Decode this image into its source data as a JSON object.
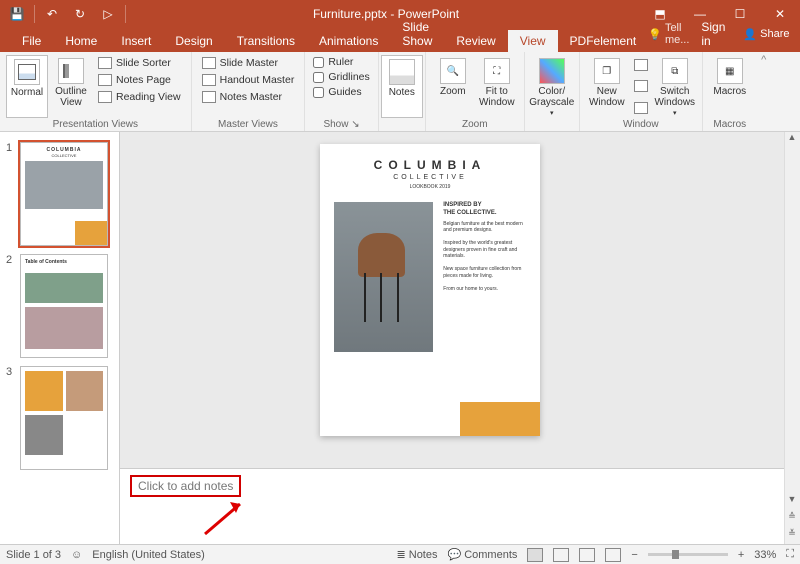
{
  "title": "Furniture.pptx - PowerPoint",
  "qat": {
    "save": "💾",
    "undo": "↶",
    "redo": "↻",
    "start": "▷"
  },
  "winctl": {
    "ribbon": "⬒",
    "min": "—",
    "max": "☐",
    "close": "✕"
  },
  "tabs": [
    "File",
    "Home",
    "Insert",
    "Design",
    "Transitions",
    "Animations",
    "Slide Show",
    "Review",
    "View",
    "PDFelement"
  ],
  "tabs_active": 8,
  "tellme": {
    "icon": "💡",
    "text": "Tell me..."
  },
  "signin": "Sign in",
  "share": {
    "icon": "👤",
    "text": "Share"
  },
  "ribbon": {
    "presentation_views": {
      "label": "Presentation Views",
      "normal": "Normal",
      "outline": "Outline\nView",
      "slide_sorter": "Slide Sorter",
      "notes_page": "Notes Page",
      "reading_view": "Reading View"
    },
    "master_views": {
      "label": "Master Views",
      "slide_master": "Slide Master",
      "handout_master": "Handout Master",
      "notes_master": "Notes Master"
    },
    "show": {
      "label": "Show",
      "ruler": "Ruler",
      "gridlines": "Gridlines",
      "guides": "Guides"
    },
    "notes_btn": "Notes",
    "zoom": {
      "label": "Zoom",
      "zoom": "Zoom",
      "fit": "Fit to\nWindow"
    },
    "colorgray": {
      "label": "",
      "btn": "Color/\nGrayscale"
    },
    "window": {
      "label": "Window",
      "new": "New\nWindow",
      "switch": "Switch\nWindows"
    },
    "macros": {
      "label": "Macros",
      "btn": "Macros"
    }
  },
  "slide": {
    "title": "COLUMBIA",
    "sub": "COLLECTIVE",
    "small": "LOOKBOOK 2019",
    "heading": "INSPIRED BY\nTHE COLLECTIVE.",
    "body": "Belgian furniture at the best modern and premium designs.\n\nInspired by the world's greatest designers proven in fine craft and materials.\n\nNew space furniture collection from pieces made for living.\n\nFrom our home to yours."
  },
  "thumbs": [
    {
      "n": "1"
    },
    {
      "n": "2",
      "title": "Table of Contents"
    },
    {
      "n": "3"
    }
  ],
  "notes_placeholder": "Click to add notes",
  "status": {
    "slide": "Slide 1 of 3",
    "lang_icon": "☺",
    "lang": "English (United States)",
    "notes": "Notes",
    "comments": "Comments",
    "zoom": "33%",
    "minus": "−",
    "plus": "+",
    "fit": "⛶"
  }
}
